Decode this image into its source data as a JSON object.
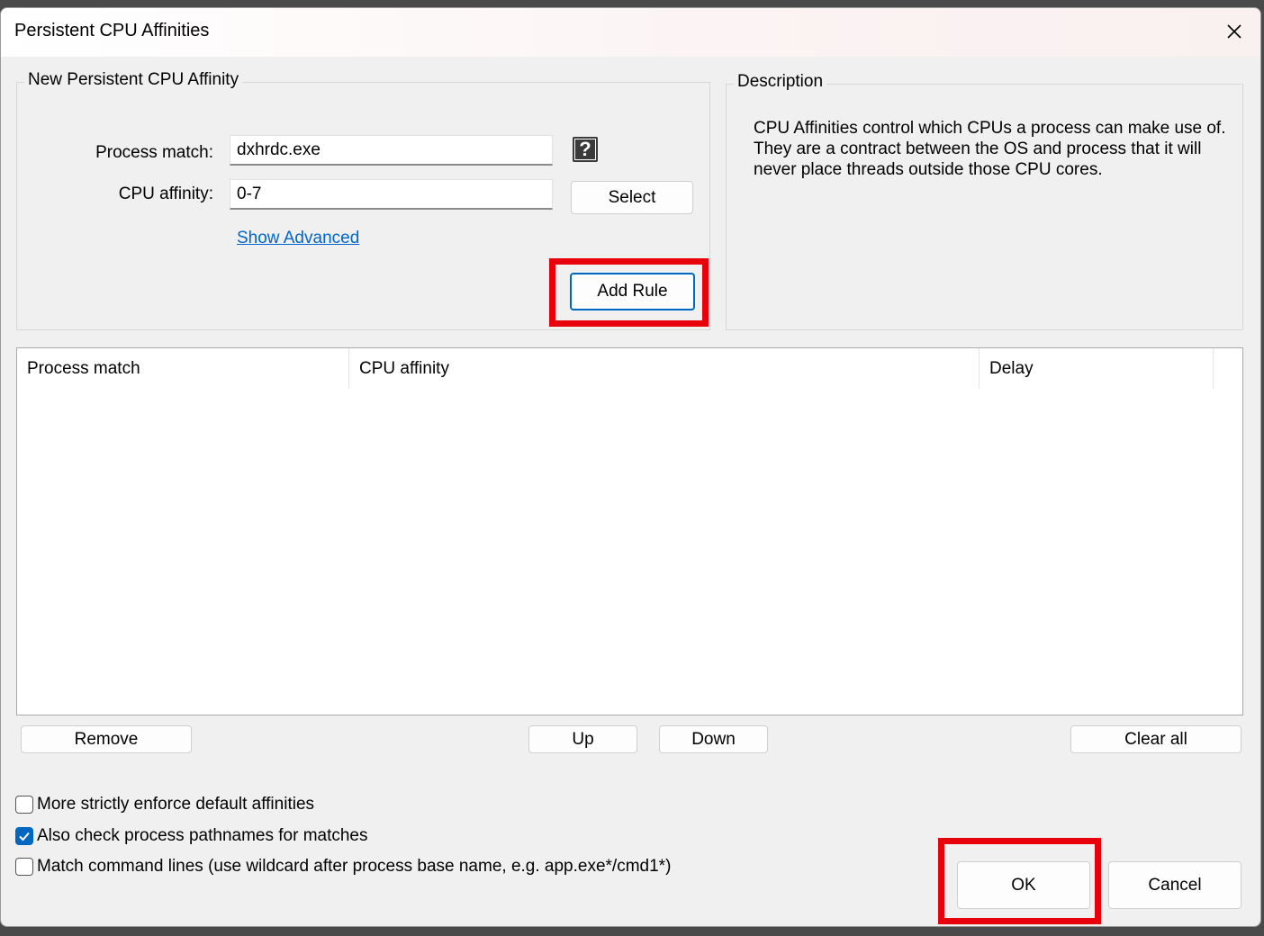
{
  "window": {
    "title": "Persistent CPU Affinities"
  },
  "new_affinity": {
    "group_label": "New Persistent CPU Affinity",
    "process_match_label": "Process match:",
    "process_match_value": "dxhrdc.exe",
    "cpu_affinity_label": "CPU affinity:",
    "cpu_affinity_value": "0-7",
    "select_label": "Select",
    "show_advanced_label": "Show Advanced",
    "add_rule_label": "Add Rule"
  },
  "description": {
    "group_label": "Description",
    "text": "CPU Affinities control which CPUs a process can make use of. They are a contract between the OS and process that it will never place threads outside those CPU cores."
  },
  "rules_list": {
    "columns": [
      "Process match",
      "CPU affinity",
      "Delay"
    ],
    "rows": []
  },
  "list_buttons": {
    "remove": "Remove",
    "up": "Up",
    "down": "Down",
    "clear_all": "Clear all"
  },
  "options": [
    {
      "label": "More strictly enforce default affinities",
      "checked": false
    },
    {
      "label": "Also check process pathnames for matches",
      "checked": true
    },
    {
      "label": "Match command lines (use wildcard after process base name, e.g. app.exe*/cmd1*)",
      "checked": false
    }
  ],
  "dialog_buttons": {
    "ok": "OK",
    "cancel": "Cancel"
  },
  "colors": {
    "highlight": "#e8000b",
    "accent": "#0067c0",
    "link": "#0066cc"
  }
}
